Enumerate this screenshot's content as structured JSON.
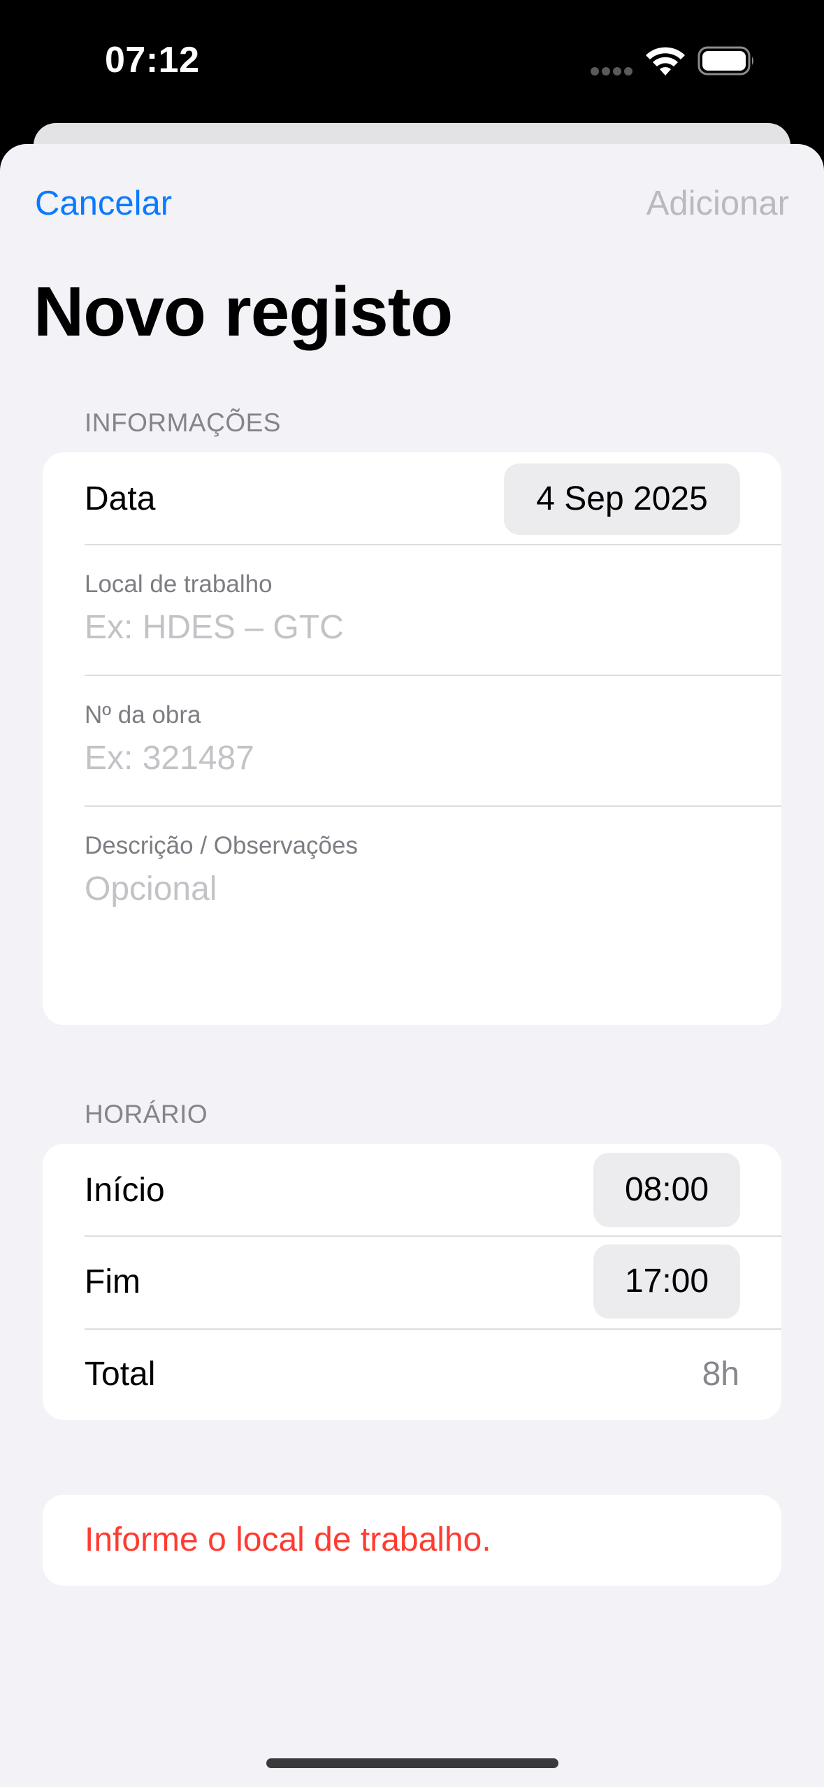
{
  "status_bar": {
    "time": "07:12"
  },
  "nav": {
    "cancel_label": "Cancelar",
    "add_label": "Adicionar",
    "title": "Novo registo"
  },
  "info_section": {
    "header": "INFORMAÇÕES",
    "date_label": "Data",
    "date_value": "4 Sep 2025",
    "workplace_caption": "Local de trabalho",
    "workplace_placeholder": "Ex: HDES – GTC",
    "job_number_caption": "Nº da obra",
    "job_number_placeholder": "Ex: 321487",
    "description_caption": "Descrição / Observações",
    "description_placeholder": "Opcional"
  },
  "schedule_section": {
    "header": "HORÁRIO",
    "start_label": "Início",
    "start_value": "08:00",
    "end_label": "Fim",
    "end_value": "17:00",
    "total_label": "Total",
    "total_value": "8h"
  },
  "validation": {
    "message": "Informe o local de trabalho."
  },
  "colors": {
    "accent": "#0a7aff",
    "disabled": "#b9b9bf",
    "error": "#ff3b30",
    "background": "#f2f2f7"
  }
}
